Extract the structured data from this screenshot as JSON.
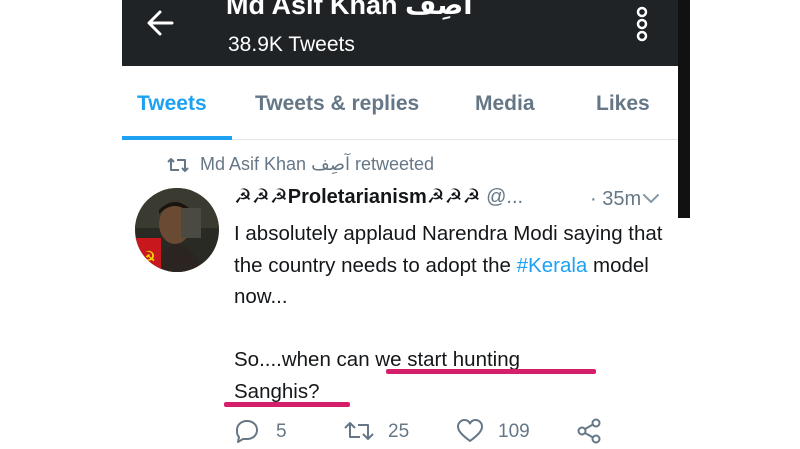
{
  "header": {
    "title": "Md Asif Khan آصِف",
    "subtitle": "38.9K Tweets",
    "back_icon": "arrow-left-icon",
    "menu_icon": "more-vertical-icon"
  },
  "tabs": [
    {
      "label": "Tweets",
      "active": true
    },
    {
      "label": "Tweets & replies",
      "active": false
    },
    {
      "label": "Media",
      "active": false
    },
    {
      "label": "Likes",
      "active": false
    }
  ],
  "retweet_context": "Md Asif Khan آصِف retweeted",
  "tweet": {
    "author_name": "☭☭☭Proletarianism☭☭☭",
    "handle": "@...",
    "time": "· 35m",
    "text_part1": "I absolutely applaud Narendra Modi saying that the country needs to adopt the ",
    "hashtag": "#Kerala",
    "text_part2": " model now...",
    "text_part3": "So....when can we start hunting Sanghis?",
    "reply_count": "5",
    "retweet_count": "25",
    "like_count": "109"
  },
  "colors": {
    "accent": "#1da1f2",
    "header_bg": "#1f2326",
    "highlight": "#d61f6b"
  }
}
